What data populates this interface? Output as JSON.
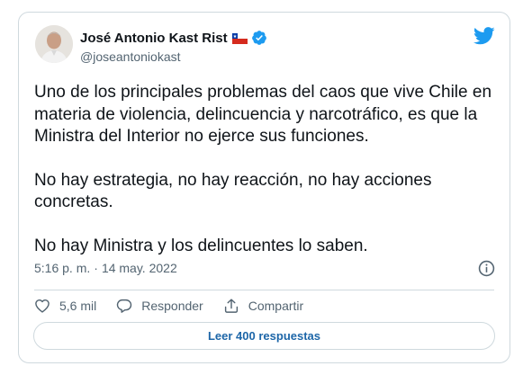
{
  "author": {
    "name": "José Antonio Kast Rist",
    "handle": "@joseantoniokast",
    "flag_icon": "chile-flag-icon",
    "verified_icon": "verified-badge-icon"
  },
  "tweet": {
    "paragraphs": [
      "Uno de los principales problemas del caos que vive Chile en materia de violencia, delincuencia y narcotráfico, es que la Ministra del Interior no ejerce sus funciones.",
      "No hay estrategia, no hay reacción, no hay acciones concretas.",
      "No hay Ministra y los delincuentes lo saben."
    ],
    "time": "5:16 p. m.",
    "separator": "·",
    "date": "14 may. 2022"
  },
  "actions": {
    "like_count": "5,6 mil",
    "reply_label": "Responder",
    "share_label": "Compartir"
  },
  "replies_button": "Leer 400 respuestas",
  "colors": {
    "twitter_blue": "#1d9bf0",
    "link_blue": "#1d66a8",
    "text": "#0f1419",
    "muted": "#536471",
    "border": "#cfd9de"
  }
}
